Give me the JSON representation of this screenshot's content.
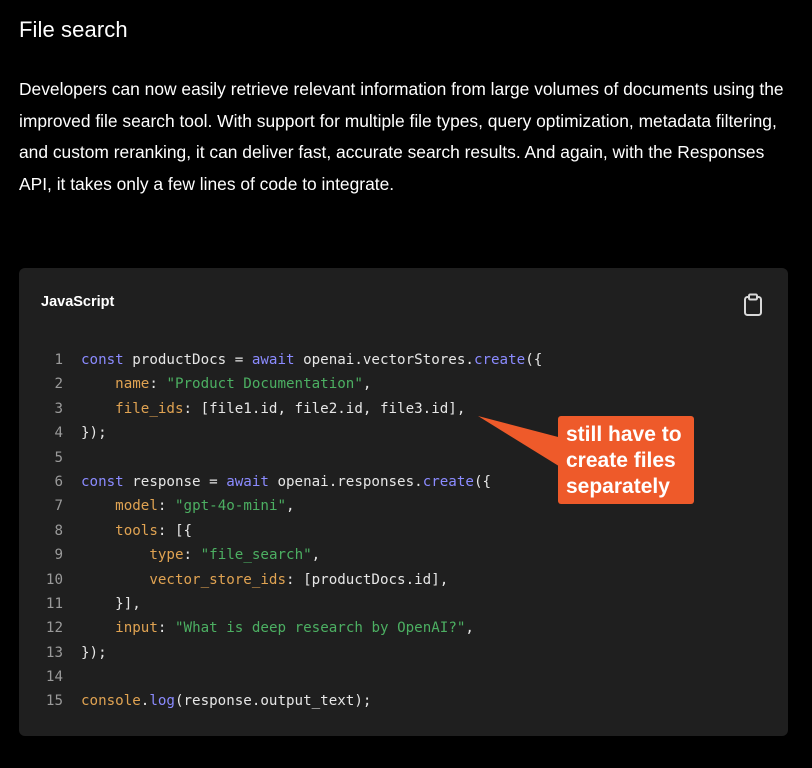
{
  "section": {
    "title": "File search",
    "body": "Developers can now easily retrieve relevant information from large volumes of documents using the improved file search tool. With support for multiple file types, query optimization, metadata filtering, and custom reranking, it can deliver fast, accurate search results. And again, with the Responses API, it takes only a few lines of code to integrate."
  },
  "code_block": {
    "language": "JavaScript",
    "copy_icon": "clipboard-icon",
    "lines": [
      {
        "n": "1",
        "tokens": [
          [
            "kw",
            "const"
          ],
          [
            "plain",
            " productDocs = "
          ],
          [
            "kw",
            "await"
          ],
          [
            "plain",
            " openai.vectorStores."
          ],
          [
            "fn",
            "create"
          ],
          [
            "plain",
            "({"
          ]
        ]
      },
      {
        "n": "2",
        "tokens": [
          [
            "plain",
            "    "
          ],
          [
            "prop",
            "name"
          ],
          [
            "plain",
            ": "
          ],
          [
            "str",
            "\"Product Documentation\""
          ],
          [
            "plain",
            ","
          ]
        ]
      },
      {
        "n": "3",
        "tokens": [
          [
            "plain",
            "    "
          ],
          [
            "prop",
            "file_ids"
          ],
          [
            "plain",
            ": [file1.id, file2.id, file3.id],"
          ]
        ]
      },
      {
        "n": "4",
        "tokens": [
          [
            "plain",
            "});"
          ]
        ]
      },
      {
        "n": "5",
        "tokens": []
      },
      {
        "n": "6",
        "tokens": [
          [
            "kw",
            "const"
          ],
          [
            "plain",
            " response = "
          ],
          [
            "kw",
            "await"
          ],
          [
            "plain",
            " openai.responses."
          ],
          [
            "fn",
            "create"
          ],
          [
            "plain",
            "({"
          ]
        ]
      },
      {
        "n": "7",
        "tokens": [
          [
            "plain",
            "    "
          ],
          [
            "prop",
            "model"
          ],
          [
            "plain",
            ": "
          ],
          [
            "str",
            "\"gpt-4o-mini\""
          ],
          [
            "plain",
            ","
          ]
        ]
      },
      {
        "n": "8",
        "tokens": [
          [
            "plain",
            "    "
          ],
          [
            "prop",
            "tools"
          ],
          [
            "plain",
            ": [{"
          ]
        ]
      },
      {
        "n": "9",
        "tokens": [
          [
            "plain",
            "        "
          ],
          [
            "prop",
            "type"
          ],
          [
            "plain",
            ": "
          ],
          [
            "str",
            "\"file_search\""
          ],
          [
            "plain",
            ","
          ]
        ]
      },
      {
        "n": "10",
        "tokens": [
          [
            "plain",
            "        "
          ],
          [
            "prop",
            "vector_store_ids"
          ],
          [
            "plain",
            ": [productDocs.id],"
          ]
        ]
      },
      {
        "n": "11",
        "tokens": [
          [
            "plain",
            "    }],"
          ]
        ]
      },
      {
        "n": "12",
        "tokens": [
          [
            "plain",
            "    "
          ],
          [
            "prop",
            "input"
          ],
          [
            "plain",
            ": "
          ],
          [
            "str",
            "\"What is deep research by OpenAI?\""
          ],
          [
            "plain",
            ","
          ]
        ]
      },
      {
        "n": "13",
        "tokens": [
          [
            "plain",
            "});"
          ]
        ]
      },
      {
        "n": "14",
        "tokens": []
      },
      {
        "n": "15",
        "tokens": [
          [
            "prop",
            "console"
          ],
          [
            "plain",
            "."
          ],
          [
            "fn",
            "log"
          ],
          [
            "plain",
            "(response.output_text);"
          ]
        ]
      }
    ]
  },
  "annotation": {
    "text": "still have to create files separately",
    "color": "#ee5a2a"
  },
  "colors": {
    "background": "#000000",
    "code_background": "#1f1f1f",
    "keyword": "#8b8bff",
    "property": "#e0a352",
    "string": "#4caf62"
  }
}
